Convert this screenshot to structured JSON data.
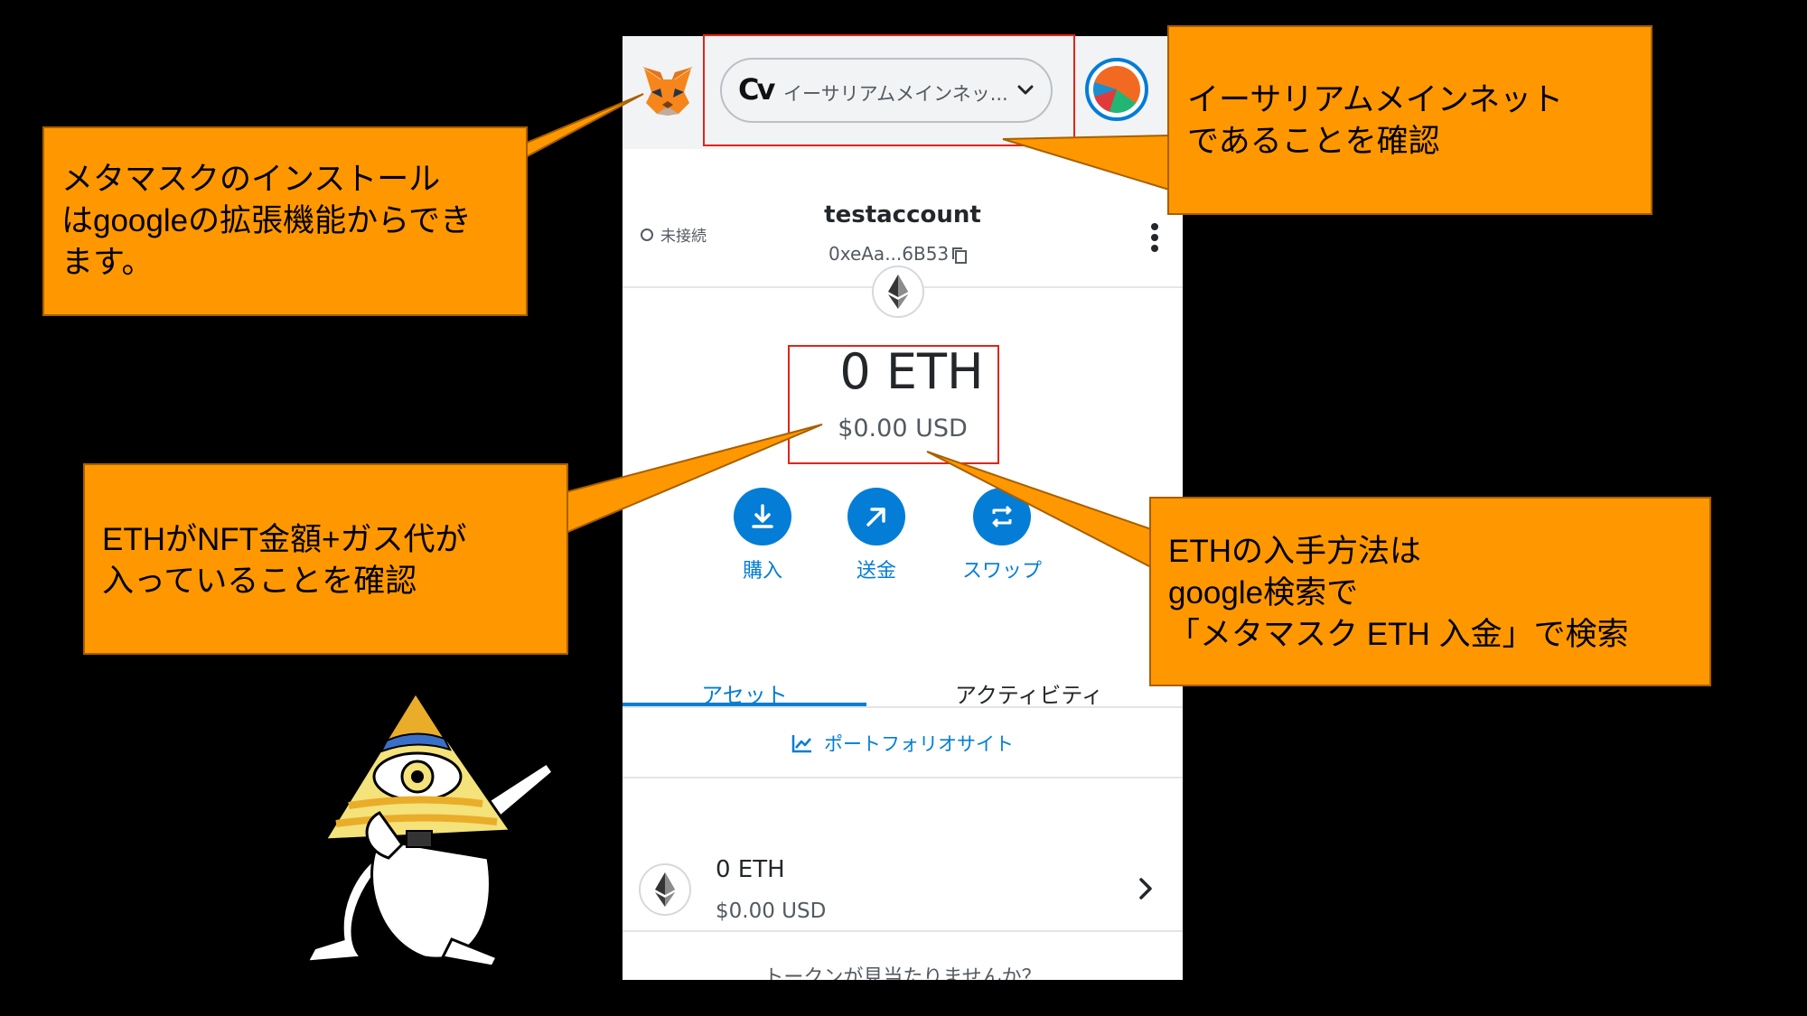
{
  "wallet": {
    "network": {
      "logo_text": "Cv",
      "label": "イーサリアムメインネッ..."
    },
    "account": {
      "connection_status": "未接続",
      "name": "testaccount",
      "address": "0xeAa...6B53"
    },
    "balance": {
      "eth": "0 ETH",
      "usd": "$0.00 USD"
    },
    "actions": [
      {
        "label": "購入",
        "icon": "download-icon"
      },
      {
        "label": "送金",
        "icon": "arrow-up-right-icon"
      },
      {
        "label": "スワップ",
        "icon": "swap-icon"
      }
    ],
    "tabs": [
      {
        "label": "アセット",
        "active": true
      },
      {
        "label": "アクティビティ",
        "active": false
      }
    ],
    "portfolio_link": "ポートフォリオサイト",
    "assets": [
      {
        "amount": "0 ETH",
        "usd": "$0.00 USD",
        "icon": "ethereum-icon"
      }
    ],
    "missing_token_text": "トークンが見当たりませんか？"
  },
  "callouts": {
    "install": [
      "メタマスクのインストール",
      "はgoogleの拡張機能からでき",
      "ます。"
    ],
    "network": [
      "イーサリアムメインネット",
      "であることを確認"
    ],
    "eth_check": [
      "ETHがNFT金額+ガス代が",
      "入っていることを確認"
    ],
    "eth_obtain": [
      "ETHの入手方法は",
      "google検索で",
      "「メタマスク ETH 入金」で検索"
    ]
  },
  "colors": {
    "background": "#000000",
    "callout": "#ff9800",
    "highlight": "#e1251b",
    "metamask_blue": "#037dd6"
  }
}
